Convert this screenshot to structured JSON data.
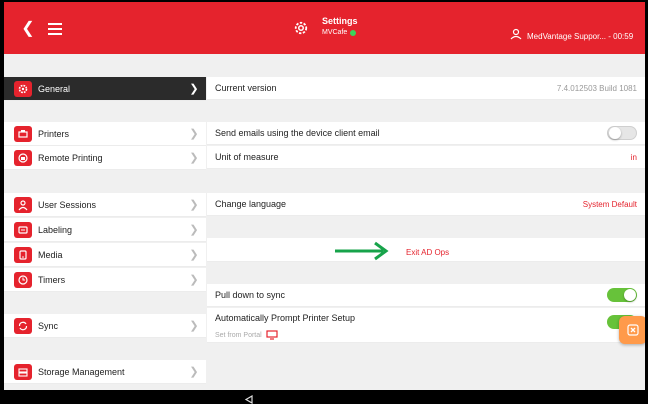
{
  "header": {
    "title": "Settings",
    "subtitle": "MVCafe",
    "user_text": "MedVantage Suppor... - 00:59",
    "color": "#e5232d",
    "icons": [
      "back-arrow-icon",
      "hamburger-menu-icon",
      "gear-icon",
      "user-icon"
    ]
  },
  "sidebar": {
    "items": [
      {
        "label": "General",
        "icon": "gear-icon",
        "active": true
      },
      {
        "label": "Printers",
        "icon": "printer-icon"
      },
      {
        "label": "Remote Printing",
        "icon": "remote-printer-icon"
      },
      {
        "label": "User Sessions",
        "icon": "user-icon"
      },
      {
        "label": "Labeling",
        "icon": "label-icon"
      },
      {
        "label": "Media",
        "icon": "media-icon"
      },
      {
        "label": "Timers",
        "icon": "timer-icon"
      },
      {
        "label": "Sync",
        "icon": "sync-icon"
      },
      {
        "label": "Storage Management",
        "icon": "storage-icon"
      }
    ]
  },
  "content": {
    "current_version_label": "Current version",
    "current_version_value": "7.4.012503 Build 1081",
    "send_emails_label": "Send emails using the device client email",
    "send_emails_enabled": false,
    "unit_label": "Unit of measure",
    "unit_value": "in",
    "language_label": "Change language",
    "language_value": "System Default",
    "exit_label": "Exit AD Ops",
    "pull_sync_label": "Pull down to sync",
    "pull_sync_enabled": true,
    "auto_prompt_label": "Automatically Prompt Printer Setup",
    "auto_prompt_sub": "Set from Portal",
    "auto_prompt_enabled": true
  },
  "colors": {
    "accent": "#e5232d",
    "toggle_on": "#67c23a",
    "fab": "#ff9a4a",
    "arrow": "#17a34a"
  }
}
